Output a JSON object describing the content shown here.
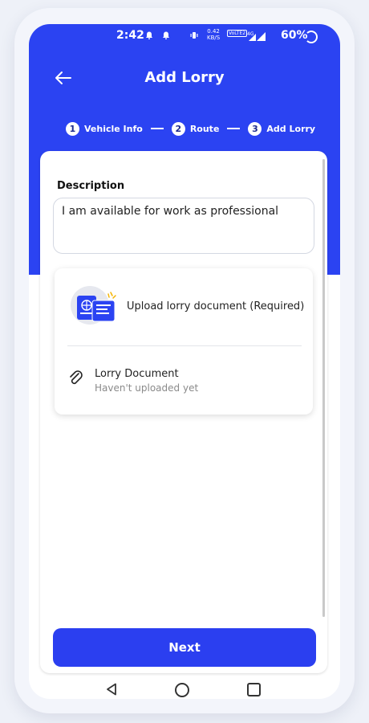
{
  "status_bar": {
    "time": "2:42",
    "speed_value": "0.42",
    "speed_unit": "KB/S",
    "lte_label": "VoLTE2",
    "network": "4G",
    "battery": "60%"
  },
  "header": {
    "title": "Add Lorry",
    "back_icon": "arrow-left-icon"
  },
  "stepper": {
    "steps": [
      {
        "number": "1",
        "label": "Vehicle Info"
      },
      {
        "number": "2",
        "label": "Route"
      },
      {
        "number": "3",
        "label": "Add Lorry"
      }
    ]
  },
  "form": {
    "description_label": "Description",
    "description_value": "I am available for work as professional"
  },
  "upload": {
    "title": "Upload lorry document (Required)",
    "document_name": "Lorry Document",
    "document_status": "Haven't uploaded yet",
    "illustration_icon": "passport-document-icon",
    "attach_icon": "paperclip-icon"
  },
  "actions": {
    "next_label": "Next"
  },
  "colors": {
    "primary": "#2b43f2",
    "button": "#2b3ff0"
  }
}
